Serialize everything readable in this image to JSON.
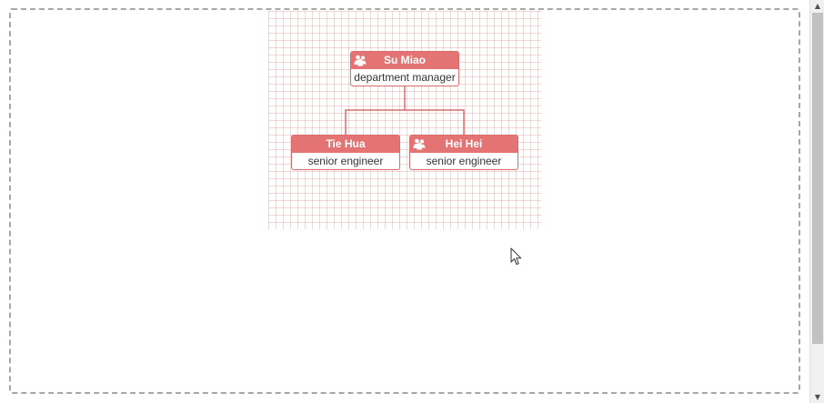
{
  "org_chart": {
    "root": {
      "name": "Su Miao",
      "title": "department manager",
      "icon": "people-icon"
    },
    "children": [
      {
        "name": "Tie Hua",
        "title": "senior engineer",
        "icon": ""
      },
      {
        "name": "Hei Hei",
        "title": "senior engineer",
        "icon": "people-icon"
      }
    ]
  },
  "colors": {
    "node_header": "#e37473",
    "node_border": "#d96b6b",
    "connector": "#d96b6b",
    "grid_line": "#e8b5b5"
  },
  "scrollbar": {
    "up_icon": "scroll-up-arrow-icon",
    "down_icon": "scroll-down-arrow-icon"
  }
}
